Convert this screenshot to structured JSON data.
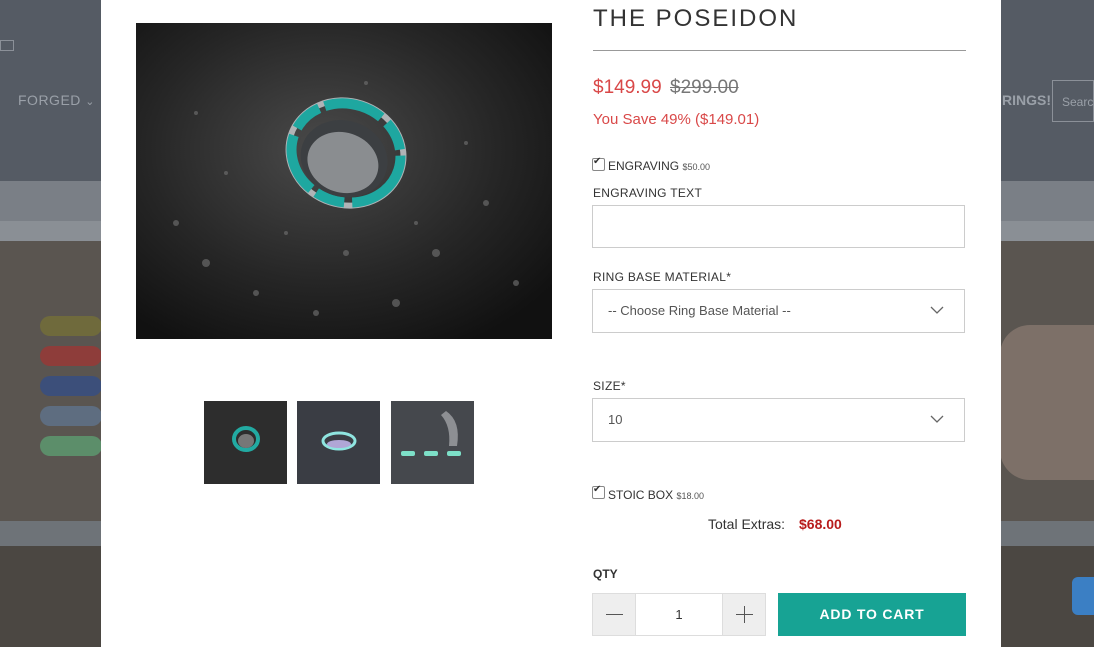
{
  "background": {
    "nav_item": "FORGED",
    "nav_promo": "RINGS!",
    "search_placeholder": "Search"
  },
  "product": {
    "title": "THE POSEIDON",
    "price": "$149.99",
    "compare_price": "$299.00",
    "savings": "You Save 49% ($149.01)"
  },
  "options": {
    "engraving": {
      "label": "ENGRAVING",
      "price": "$50.00",
      "checked": true
    },
    "engraving_text": {
      "label": "ENGRAVING TEXT",
      "value": ""
    },
    "ring_base_material": {
      "label": "RING BASE MATERIAL*",
      "selected": "-- Choose Ring Base Material --"
    },
    "size": {
      "label": "SIZE*",
      "selected": "10"
    },
    "stoic_box": {
      "label": "STOIC BOX",
      "price": "$18.00",
      "checked": true
    }
  },
  "extras": {
    "label": "Total Extras:",
    "value": "$68.00"
  },
  "cart": {
    "qty_label": "QTY",
    "qty": "1",
    "add_label": "ADD TO CART"
  },
  "colors": {
    "accent": "#17a394",
    "sale": "#d94848",
    "extras": "#b81c1c"
  },
  "icons": [
    "mail-icon",
    "chevron-down-icon",
    "minus-icon",
    "plus-icon",
    "chat-icon"
  ]
}
